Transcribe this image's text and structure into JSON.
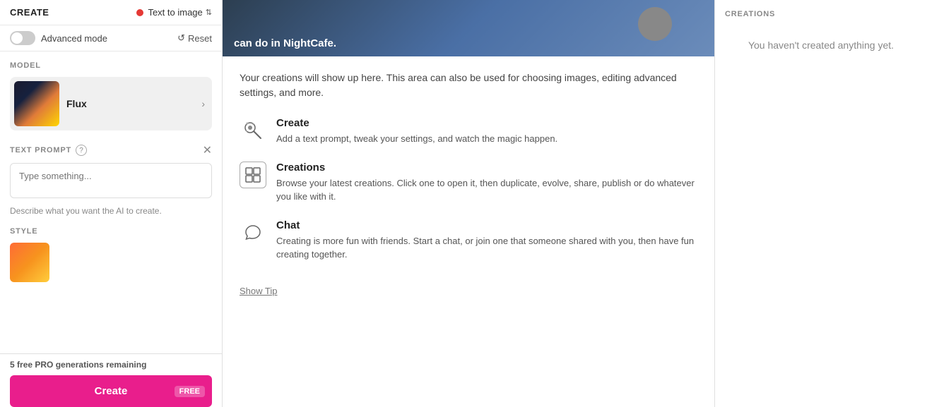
{
  "leftPanel": {
    "createLabel": "CREATE",
    "modeSelector": {
      "label": "Text to image",
      "icon": "chevron-up-down-icon"
    },
    "advancedMode": {
      "label": "Advanced mode",
      "enabled": false
    },
    "resetLabel": "Reset",
    "modelSection": {
      "sectionLabel": "MODEL",
      "modelName": "Flux",
      "chevronLabel": "›"
    },
    "textPrompt": {
      "sectionLabel": "TEXT PROMPT",
      "placeholder": "Type something...",
      "hintText": "Describe what you want the AI to create."
    },
    "styleSection": {
      "sectionLabel": "STYLE"
    },
    "bottomBar": {
      "freeGenCount": "5",
      "freeGenText": "free PRO generations remaining",
      "createLabel": "Create",
      "freeBadge": "FREE"
    }
  },
  "middlePanel": {
    "heroText": "can do in NightCafe.",
    "description": "Your creations will show up here. This area can also be used for choosing images, editing advanced settings, and more.",
    "features": [
      {
        "id": "create",
        "title": "Create",
        "description": "Add a text prompt, tweak your settings, and watch the magic happen.",
        "iconType": "magic"
      },
      {
        "id": "creations",
        "title": "Creations",
        "description": "Browse your latest creations. Click one to open it, then duplicate, evolve, share, publish or do whatever you like with it.",
        "iconType": "image-grid"
      },
      {
        "id": "chat",
        "title": "Chat",
        "description": "Creating is more fun with friends. Start a chat, or join one that someone shared with you, then have fun creating together.",
        "iconType": "chat"
      }
    ],
    "showTipLabel": "Show Tip"
  },
  "rightPanel": {
    "sectionLabel": "CREATIONS",
    "emptyText": "You haven't created anything yet."
  }
}
